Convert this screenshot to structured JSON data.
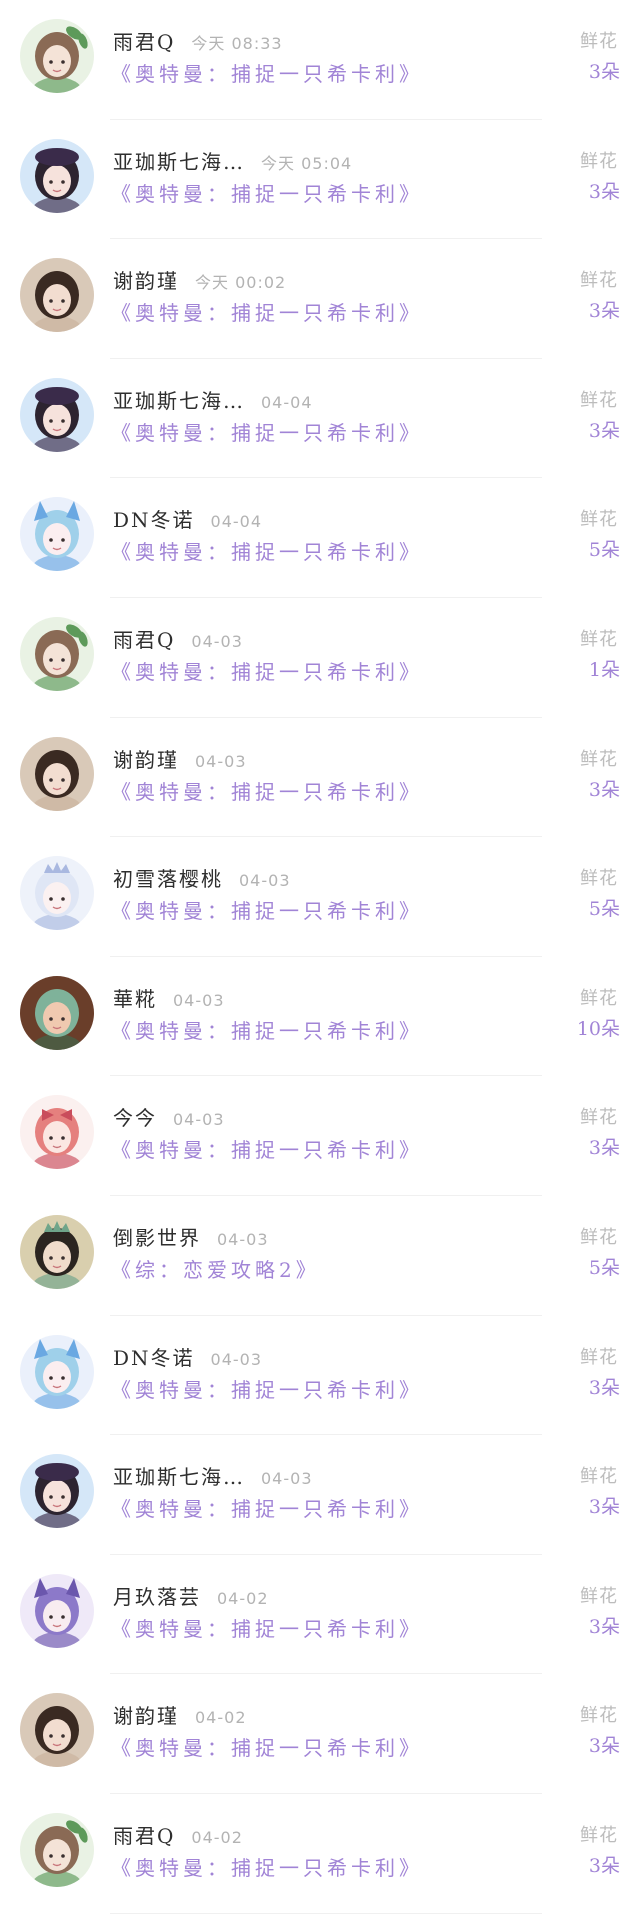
{
  "colors": {
    "book_title": "#a184d6",
    "count": "#a184d6",
    "username": "#2e2e2e",
    "time": "#b3b3b3",
    "gift_label": "#bcbcbc",
    "divider": "#f0f0f0"
  },
  "records": [
    {
      "user": "雨君Q",
      "time": "今天 08:33",
      "book": "《奥特曼：捕捉一只希卡利》",
      "gift": "鲜花",
      "count": "3朵",
      "avatar": "cartoon-girl-avatar"
    },
    {
      "user": "亚珈斯七海…",
      "time": "今天 05:04",
      "book": "《奥特曼：捕捉一只希卡利》",
      "gift": "鲜花",
      "count": "3朵",
      "avatar": "girl-beret-avatar"
    },
    {
      "user": "谢韵瑾",
      "time": "今天 00:02",
      "book": "《奥特曼：捕捉一只希卡利》",
      "gift": "鲜花",
      "count": "3朵",
      "avatar": "girl-photo-avatar"
    },
    {
      "user": "亚珈斯七海…",
      "time": "04-04",
      "book": "《奥特曼：捕捉一只希卡利》",
      "gift": "鲜花",
      "count": "3朵",
      "avatar": "girl-beret-avatar"
    },
    {
      "user": "DN冬诺",
      "time": "04-04",
      "book": "《奥特曼：捕捉一只希卡利》",
      "gift": "鲜花",
      "count": "5朵",
      "avatar": "anime-blue-avatar"
    },
    {
      "user": "雨君Q",
      "time": "04-03",
      "book": "《奥特曼：捕捉一只希卡利》",
      "gift": "鲜花",
      "count": "1朵",
      "avatar": "cartoon-girl-avatar"
    },
    {
      "user": "谢韵瑾",
      "time": "04-03",
      "book": "《奥特曼：捕捉一只希卡利》",
      "gift": "鲜花",
      "count": "3朵",
      "avatar": "girl-photo-avatar"
    },
    {
      "user": "初雪落樱桃",
      "time": "04-03",
      "book": "《奥特曼：捕捉一只希卡利》",
      "gift": "鲜花",
      "count": "5朵",
      "avatar": "anime-white-avatar"
    },
    {
      "user": "華糀",
      "time": "04-03",
      "book": "《奥特曼：捕捉一只希卡利》",
      "gift": "鲜花",
      "count": "10朵",
      "avatar": "green-hair-avatar"
    },
    {
      "user": "今今",
      "time": "04-03",
      "book": "《奥特曼：捕捉一只希卡利》",
      "gift": "鲜花",
      "count": "3朵",
      "avatar": "anime-pink-avatar"
    },
    {
      "user": "倒影世界",
      "time": "04-03",
      "book": "《综：恋爱攻略2》",
      "gift": "鲜花",
      "count": "5朵",
      "avatar": "costume-girl-avatar"
    },
    {
      "user": "DN冬诺",
      "time": "04-03",
      "book": "《奥特曼：捕捉一只希卡利》",
      "gift": "鲜花",
      "count": "3朵",
      "avatar": "anime-blue-avatar"
    },
    {
      "user": "亚珈斯七海…",
      "time": "04-03",
      "book": "《奥特曼：捕捉一只希卡利》",
      "gift": "鲜花",
      "count": "3朵",
      "avatar": "girl-beret-avatar"
    },
    {
      "user": "月玖落芸",
      "time": "04-02",
      "book": "《奥特曼：捕捉一只希卡利》",
      "gift": "鲜花",
      "count": "3朵",
      "avatar": "anime-purple-avatar"
    },
    {
      "user": "谢韵瑾",
      "time": "04-02",
      "book": "《奥特曼：捕捉一只希卡利》",
      "gift": "鲜花",
      "count": "3朵",
      "avatar": "girl-photo-avatar"
    },
    {
      "user": "雨君Q",
      "time": "04-02",
      "book": "《奥特曼：捕捉一只希卡利》",
      "gift": "鲜花",
      "count": "3朵",
      "avatar": "cartoon-girl-avatar"
    }
  ]
}
